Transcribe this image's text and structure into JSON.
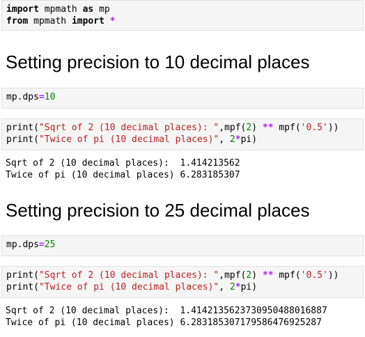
{
  "cell1": {
    "line1": "import mpmath as mp",
    "line2": "from mpmath import *"
  },
  "h1": "Setting precision to 10 decimal places",
  "cell2": {
    "code": "mp.dps=10"
  },
  "cell3": {
    "line1": "print(\"Sqrt of 2 (10 decimal places): \",mpf(2) ** mpf('0.5'))",
    "line2": "print(\"Twice of pi (10 decimal places)\", 2*pi)"
  },
  "out3": {
    "line1": "Sqrt of 2 (10 decimal places):  1.414213562",
    "line2": "Twice of pi (10 decimal places) 6.283185307"
  },
  "h2": "Setting precision to 25 decimal places",
  "cell4": {
    "code": "mp.dps=25"
  },
  "cell5": {
    "line1": "print(\"Sqrt of 2 (10 decimal places): \",mpf(2) ** mpf('0.5'))",
    "line2": "print(\"Twice of pi (10 decimal places)\", 2*pi)"
  },
  "out5": {
    "line1": "Sqrt of 2 (10 decimal places):  1.4142135623730950488016887",
    "line2": "Twice of pi (10 decimal places) 6.283185307179586476925287"
  }
}
